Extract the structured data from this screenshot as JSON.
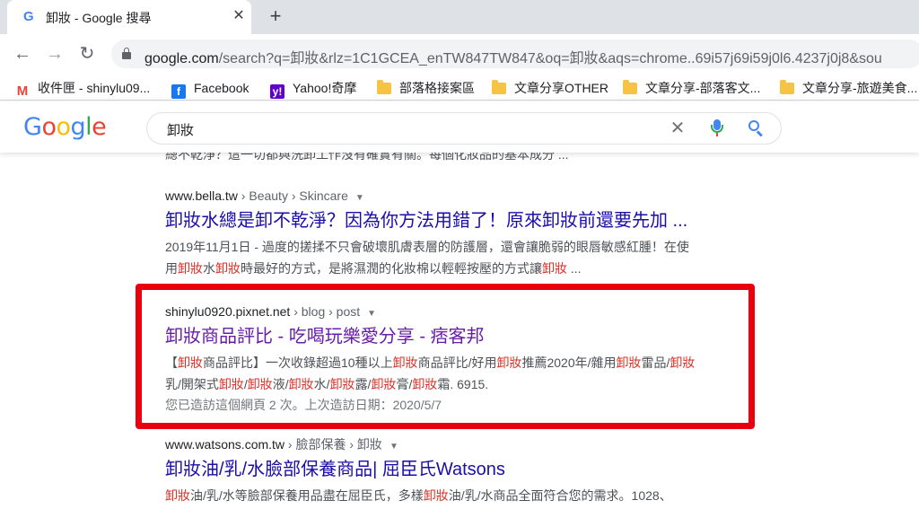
{
  "tab": {
    "favicon": "G",
    "title": "卸妝 - Google 搜尋",
    "close": "✕",
    "new_tab": "+"
  },
  "toolbar": {
    "back": "←",
    "forward": "→",
    "reload": "↻",
    "url_host": "google.com",
    "url_path": "/search?q=卸妝&rlz=1C1GCEA_enTW847TW847&oq=卸妝&aqs=chrome..69i57j69i59j0l6.4237j0j8&sou"
  },
  "bookmarks": [
    {
      "icon": "M",
      "label": "收件匣 - shinylu09..."
    },
    {
      "icon": "f",
      "label": "Facebook"
    },
    {
      "icon": "y!",
      "label": "Yahoo!奇摩"
    },
    {
      "icon": "folder",
      "label": "部落格接案區"
    },
    {
      "icon": "folder",
      "label": "文章分享OTHER"
    },
    {
      "icon": "folder",
      "label": "文章分享-部落客文..."
    },
    {
      "icon": "folder",
      "label": "文章分享-旅遊美食..."
    }
  ],
  "google": {
    "logo": [
      "G",
      "o",
      "o",
      "g",
      "l",
      "e"
    ],
    "logo_colors": [
      "#4285f4",
      "#ea4335",
      "#fbbc05",
      "#4285f4",
      "#34a853",
      "#ea4335"
    ],
    "query": "卸妝",
    "clear": "✕"
  },
  "results": {
    "clipped_snippet": "總不乾淨？這一切都與洗卸工作沒有確實有關。每個化妝品的基本成分 ...",
    "items": [
      {
        "site": "www.bella.tw",
        "crumbs": " › Beauty › Skincare",
        "title": "卸妝水總是卸不乾淨？因為你方法用錯了！原來卸妝前還要先加 ...",
        "snippet_line1": "2019年11月1日 - 過度的搓揉不只會破壞肌膚表層的防護層，還會讓脆弱的眼唇敏感紅腫！在使",
        "snippet_line2_a": "用",
        "snippet_line2_b": "卸妝",
        "snippet_line2_c": "水",
        "snippet_line2_d": "卸妝",
        "snippet_line2_e": "時最好的方式，是將濕潤的化妝棉以輕輕按壓的方式讓",
        "snippet_line2_f": "卸妝",
        "snippet_line2_g": " ..."
      },
      {
        "site": "shinylu0920.pixnet.net",
        "crumbs": " › blog › post",
        "title": "卸妝商品評比 - 吃喝玩樂愛分享 - 痞客邦",
        "snippet_line1_a": "【",
        "snippet_line1_b": "卸妝",
        "snippet_line1_c": "商品評比】一次收錄超過10種以上",
        "snippet_line1_d": "卸妝",
        "snippet_line1_e": "商品評比/好用",
        "snippet_line1_f": "卸妝",
        "snippet_line1_g": "推薦2020年/雜用",
        "snippet_line1_h": "卸妝",
        "snippet_line1_i": "雷品/",
        "snippet_line1_j": "卸妝",
        "snippet_line2_a": "乳/開架式",
        "snippet_line2_b": "卸妝",
        "snippet_line2_c": "/",
        "snippet_line2_d": "卸妝",
        "snippet_line2_e": "液/",
        "snippet_line2_f": "卸妝",
        "snippet_line2_g": "水/",
        "snippet_line2_h": "卸妝",
        "snippet_line2_i": "露/",
        "snippet_line2_j": "卸妝",
        "snippet_line2_k": "膏/",
        "snippet_line2_l": "卸妝",
        "snippet_line2_m": "霜. 6915.",
        "visit_note": "您已造訪這個網頁 2 次。上次造訪日期：2020/5/7"
      },
      {
        "site": "www.watsons.com.tw",
        "crumbs": " › 臉部保養 › 卸妝",
        "title": "卸妝油/乳/水臉部保養商品| 屈臣氏Watsons",
        "snippet_line1_a": "卸妝",
        "snippet_line1_b": "油/乳/水等臉部保養用品盡在屈臣氏，多樣",
        "snippet_line1_c": "卸妝",
        "snippet_line1_d": "油/乳/水商品全面符合您的需求。1028、"
      }
    ]
  }
}
